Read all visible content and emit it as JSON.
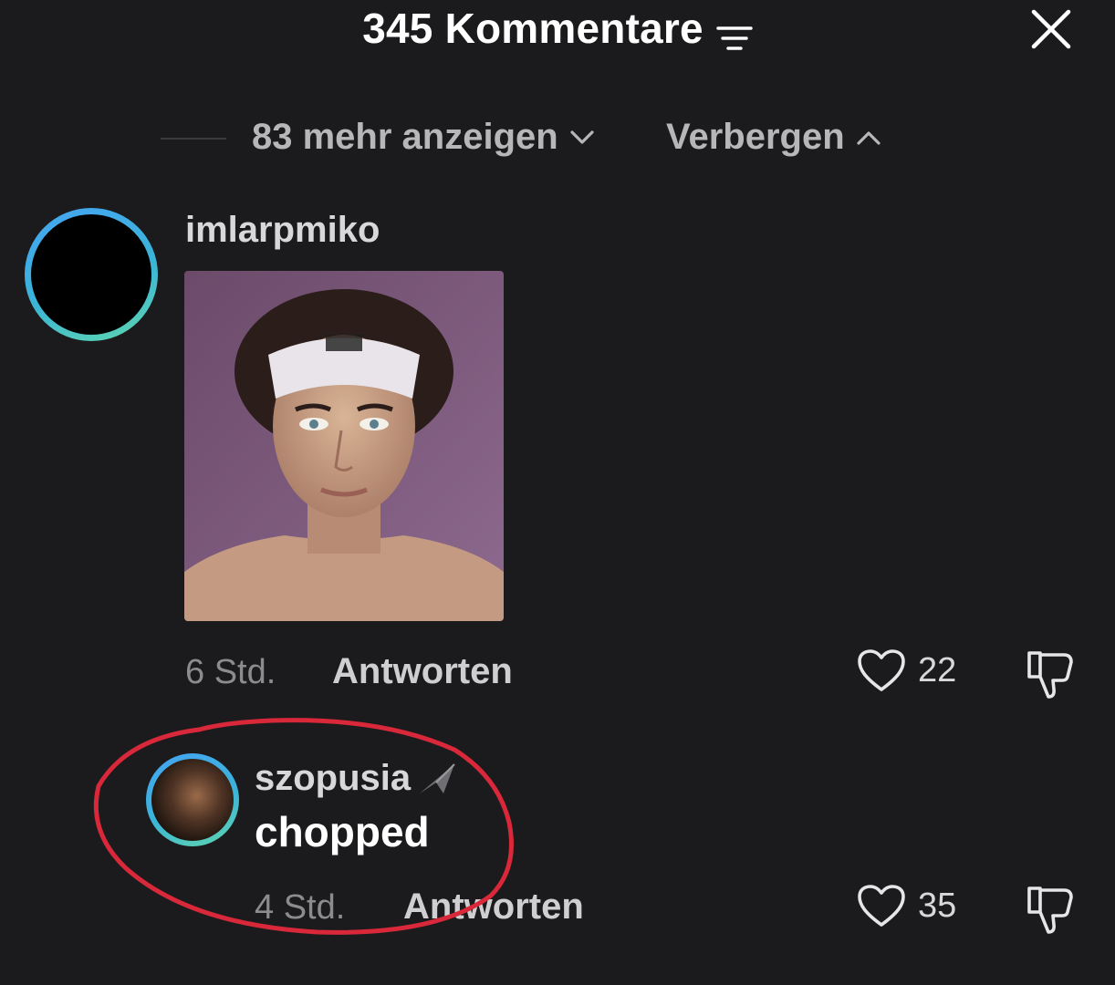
{
  "header": {
    "title": "345 Kommentare",
    "filter_icon": "filter-sort-icon",
    "close_icon": "close-icon"
  },
  "replies_bar": {
    "show_more_label": "83 mehr anzeigen",
    "hide_label": "Verbergen"
  },
  "comments": [
    {
      "username": "imlarpmiko",
      "media": "photo",
      "time": "6 Std.",
      "reply_label": "Antworten",
      "likes": "22"
    },
    {
      "username": "szopusia",
      "text": "chopped",
      "time": "4 Std.",
      "reply_label": "Antworten",
      "likes": "35"
    }
  ],
  "colors": {
    "background": "#1b1b1d",
    "avatar_ring": "#45a4f2",
    "highlight": "#d8283a"
  }
}
